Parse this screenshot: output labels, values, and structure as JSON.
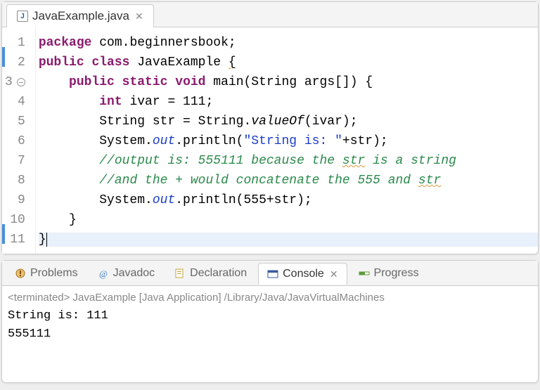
{
  "editor": {
    "tab_filename": "JavaExample.java",
    "lines": [
      {
        "n": 1,
        "mark": "",
        "fold": false,
        "html": "<span class='kw'>package</span> com.beginnersbook;"
      },
      {
        "n": 2,
        "mark": "blue",
        "fold": false,
        "html": "<span class='kw'>public</span> <span class='kw'>class</span> JavaExample <span class='squiggle'>{</span>"
      },
      {
        "n": 3,
        "mark": "",
        "fold": true,
        "html": "    <span class='kw'>public</span> <span class='kw'>static</span> <span class='kw'>void</span> main(String args[]) {"
      },
      {
        "n": 4,
        "mark": "",
        "fold": false,
        "html": "        <span class='kw'>int</span> ivar = 111;"
      },
      {
        "n": 5,
        "mark": "",
        "fold": false,
        "html": "        String str = String.<span class='ital'>valueOf</span>(ivar);"
      },
      {
        "n": 6,
        "mark": "",
        "fold": false,
        "html": "        System.<span class='ital str'>out</span>.println(<span class='str'>\"String is: \"</span>+str);"
      },
      {
        "n": 7,
        "mark": "",
        "fold": false,
        "html": "        <span class='com'>//output is: 555111 because the <span class='squiggle'>str</span> is a string</span>"
      },
      {
        "n": 8,
        "mark": "",
        "fold": false,
        "html": "        <span class='com'>//and the + would concatenate the 555 and <span class='squiggle'>str</span></span>"
      },
      {
        "n": 9,
        "mark": "",
        "fold": false,
        "html": "        System.<span class='ital str'>out</span>.println(555+str);"
      },
      {
        "n": 10,
        "mark": "",
        "fold": false,
        "html": "    }"
      },
      {
        "n": 11,
        "mark": "blue",
        "fold": false,
        "html": "<span class='current-hl'>}<span class='cursor'></span>                                                                            </span>"
      }
    ]
  },
  "views": {
    "problems": "Problems",
    "javadoc": "Javadoc",
    "declaration": "Declaration",
    "console": "Console",
    "progress": "Progress"
  },
  "console": {
    "status": "<terminated> JavaExample [Java Application] /Library/Java/JavaVirtualMachines",
    "out1": "String is: 111",
    "out2": "555111"
  }
}
